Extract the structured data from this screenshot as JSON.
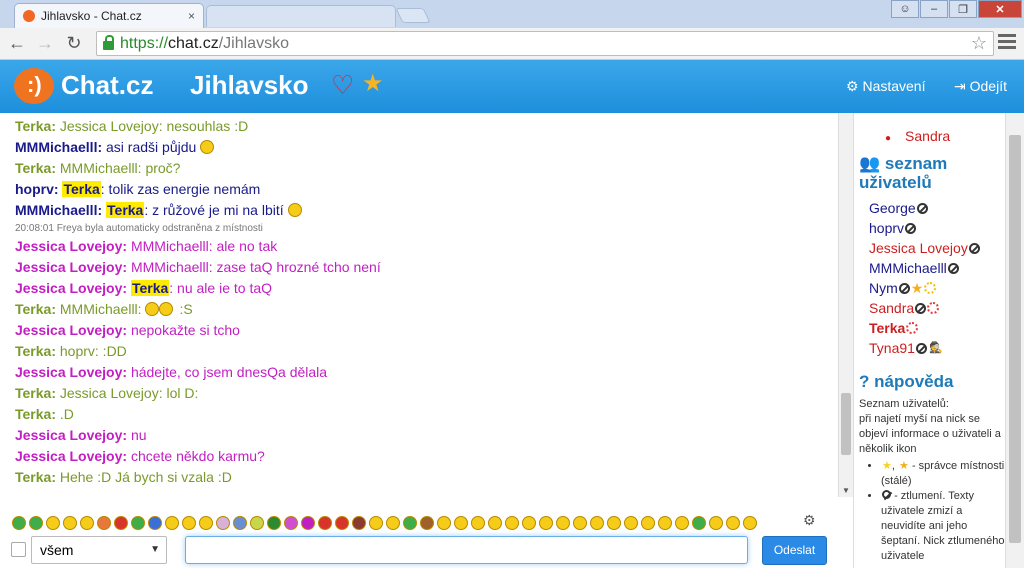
{
  "browser": {
    "tab_title": "Jihlavsko - Chat.cz",
    "tab_close": "×",
    "url_https": "https://",
    "url_host": "chat.cz",
    "url_path": "/Jihlavsko"
  },
  "header": {
    "brand": "Chat.cz",
    "room": "Jihlavsko",
    "settings": "Nastavení",
    "logout": "Odejít"
  },
  "messages": [
    {
      "nick": "Terka:",
      "text": "Jessica Lovejoy: nesouhlas :D",
      "nick_color": "#7a9a2a",
      "text_color": "#7a9a2a"
    },
    {
      "nick": "MMMichaelll:",
      "text": "asi radši půjdu",
      "nick_color": "#1a1a8a",
      "text_color": "#1a1a8a"
    },
    {
      "nick": "Terka:",
      "text": "MMMichaelll: proč?",
      "nick_color": "#7a9a2a",
      "text_color": "#7a9a2a"
    },
    {
      "nick": "hoprv:",
      "hl": "Terka",
      "text": ": tolik zas energie nemám",
      "nick_color": "#1a1a8a",
      "text_color": "#1a1a8a"
    },
    {
      "nick": "MMMichaelll:",
      "hl": "Terka",
      "text": ": z růžové je mi na lbití",
      "nick_color": "#1a1a8a",
      "text_color": "#1a1a8a"
    },
    {
      "system": "20:08:01 Freya byla automaticky odstraněna z místnosti"
    },
    {
      "nick": "Jessica Lovejoy:",
      "text": "MMMichaelll: ale no tak",
      "nick_color": "#c21fc2",
      "text_color": "#c21fc2"
    },
    {
      "nick": "Jessica Lovejoy:",
      "text": "MMMichaelll: zase taQ hrozné tcho není",
      "nick_color": "#c21fc2",
      "text_color": "#c21fc2"
    },
    {
      "nick": "Jessica Lovejoy:",
      "hl": "Terka",
      "text": ": nu ale ie to taQ",
      "nick_color": "#c21fc2",
      "text_color": "#c21fc2"
    },
    {
      "nick": "Terka:",
      "text": "MMMichaelll:",
      "extra": ":S",
      "nick_color": "#7a9a2a",
      "text_color": "#7a9a2a"
    },
    {
      "nick": "Jessica Lovejoy:",
      "text": "nepokažte si tcho",
      "nick_color": "#c21fc2",
      "text_color": "#c21fc2"
    },
    {
      "nick": "Terka:",
      "text": "hoprv: :DD",
      "nick_color": "#7a9a2a",
      "text_color": "#7a9a2a"
    },
    {
      "nick": "Jessica Lovejoy:",
      "text": "hádejte, co jsem dnesQa dělala",
      "nick_color": "#c21fc2",
      "text_color": "#c21fc2"
    },
    {
      "nick": "Terka:",
      "text": "Jessica Lovejoy: lol D:",
      "nick_color": "#7a9a2a",
      "text_color": "#7a9a2a"
    },
    {
      "nick": "Terka:",
      "text": ".D",
      "nick_color": "#7a9a2a",
      "text_color": "#7a9a2a"
    },
    {
      "nick": "Jessica Lovejoy:",
      "text": "nu",
      "nick_color": "#c21fc2",
      "text_color": "#c21fc2"
    },
    {
      "nick": "Jessica Lovejoy:",
      "text": "chcete někdo karmu?",
      "nick_color": "#c21fc2",
      "text_color": "#c21fc2"
    },
    {
      "nick": "Terka:",
      "text": "Hehe :D Já bych si vzala :D",
      "nick_color": "#7a9a2a",
      "text_color": "#7a9a2a"
    }
  ],
  "sidebar": {
    "top_item": "Sandra",
    "users_heading_line1": "seznam",
    "users_heading_line2": "uživatelů",
    "users": [
      {
        "name": "George",
        "color": "#1a1a8a",
        "icons": [
          "ban-icon"
        ]
      },
      {
        "name": "hoprv",
        "color": "#1a1a8a",
        "icons": [
          "ban-icon"
        ]
      },
      {
        "name": "Jessica Lovejoy",
        "color": "#cc1f1f",
        "icons": [
          "ban-icon"
        ]
      },
      {
        "name": "MMMichaelll",
        "color": "#1a1a8a",
        "icons": [
          "ban-icon"
        ]
      },
      {
        "name": "Nym",
        "color": "#1a1a8a",
        "icons": [
          "ban-icon",
          "star-icon",
          "sun-icon"
        ]
      },
      {
        "name": "Sandra",
        "color": "#cc1f1f",
        "icons": [
          "ban-icon",
          "sun-red-icon"
        ]
      },
      {
        "name": "Terka",
        "color": "#cc1f1f",
        "bold": true,
        "icons": [
          "sun-red-icon"
        ]
      },
      {
        "name": "Tyna91",
        "color": "#cc1f1f",
        "icons": [
          "ban-icon",
          "spy-icon"
        ]
      }
    ],
    "help_heading": "nápověda",
    "help_title": "Seznam uživatelů:",
    "help_text": "při najetí myší na nick se objeví informace o uživateli a několik ikon",
    "help_item1": "- správce místnosti (stálé)",
    "help_item2": "- ztlumení. Texty uživatele zmizí a neuvidíte ani jeho šeptaní. Nick ztlumeného uživatele"
  },
  "composer": {
    "recipient": "všem",
    "input_value": "",
    "send": "Odeslat"
  }
}
